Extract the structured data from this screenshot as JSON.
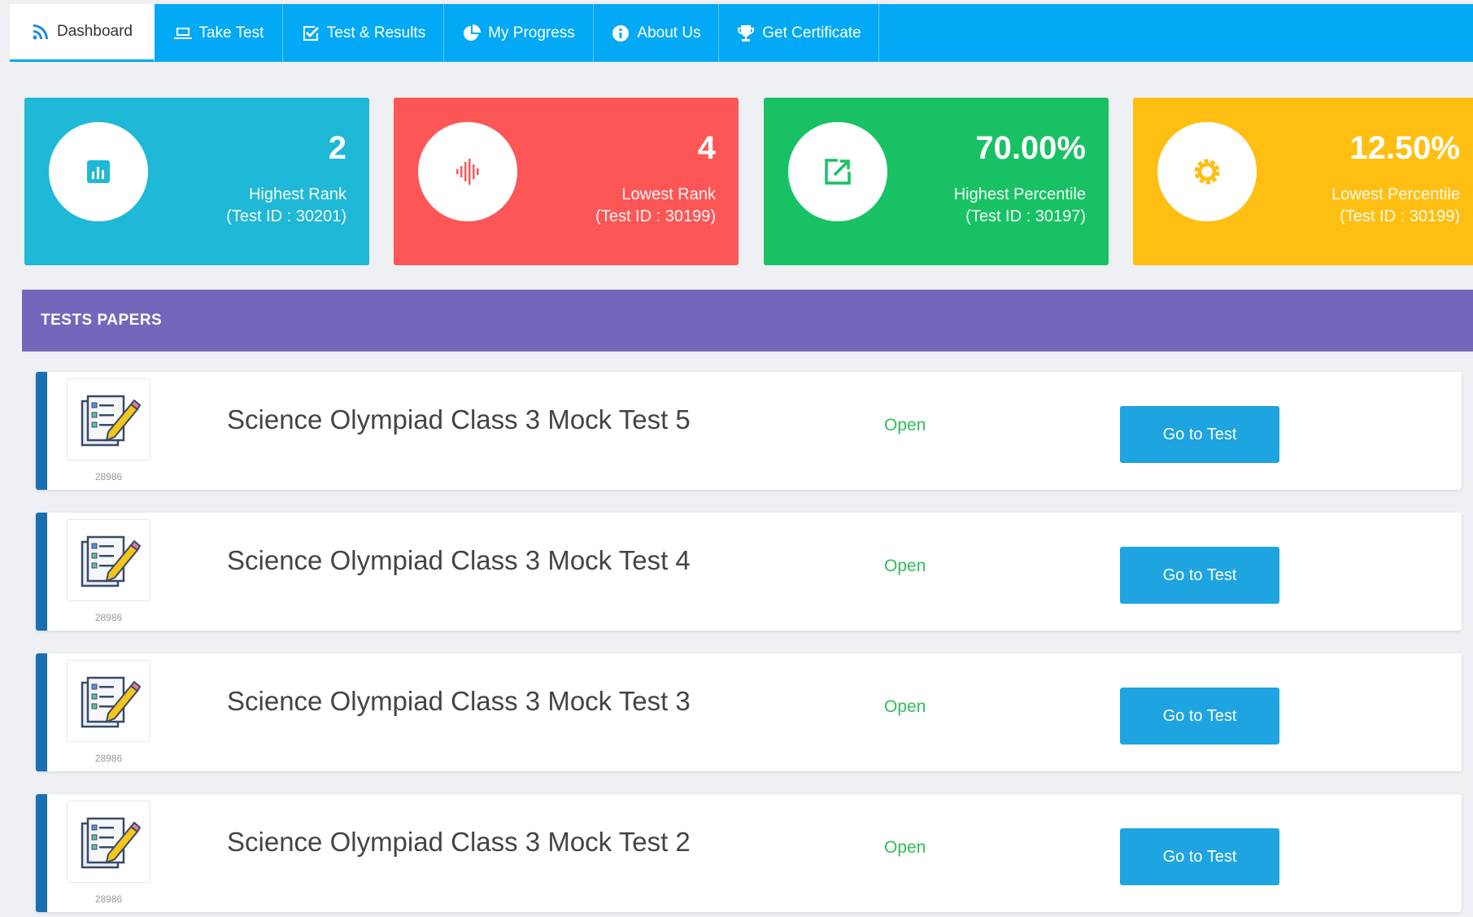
{
  "nav": {
    "items": [
      {
        "label": "Dashboard",
        "icon": "rss-icon",
        "active": true
      },
      {
        "label": "Take Test",
        "icon": "laptop-icon"
      },
      {
        "label": "Test & Results",
        "icon": "checkbox-icon"
      },
      {
        "label": "My Progress",
        "icon": "pie-chart-icon"
      },
      {
        "label": "About Us",
        "icon": "info-icon"
      },
      {
        "label": "Get Certificate",
        "icon": "trophy-icon"
      }
    ]
  },
  "stats": [
    {
      "value": "2",
      "label_line1": "Highest Rank",
      "label_line2": "(Test ID : 30201)",
      "color": "#1fb8d6",
      "icon": "bar-chart-icon"
    },
    {
      "value": "4",
      "label_line1": "Lowest Rank",
      "label_line2": "(Test ID : 30199)",
      "color": "#fd5656",
      "icon": "audio-wave-icon"
    },
    {
      "value": "70.00%",
      "label_line1": "Highest Percentile",
      "label_line2": "(Test ID : 30197)",
      "color": "#18c264",
      "icon": "external-link-icon"
    },
    {
      "value": "12.50%",
      "label_line1": "Lowest Percentile",
      "label_line2": "(Test ID : 30199)",
      "color": "#ffbf12",
      "icon": "gear-icon"
    }
  ],
  "section": {
    "title": "TESTS PAPERS"
  },
  "tests": [
    {
      "id": "28986",
      "title": "Science Olympiad Class 3 Mock Test 5",
      "status": "Open",
      "button": "Go to Test"
    },
    {
      "id": "28986",
      "title": "Science Olympiad Class 3 Mock Test 4",
      "status": "Open",
      "button": "Go to Test"
    },
    {
      "id": "28986",
      "title": "Science Olympiad Class 3 Mock Test 3",
      "status": "Open",
      "button": "Go to Test"
    },
    {
      "id": "28986",
      "title": "Science Olympiad Class 3 Mock Test 2",
      "status": "Open",
      "button": "Go to Test"
    }
  ],
  "colors": {
    "nav": "#03a9f4",
    "section": "#7467bb",
    "row_accent": "#1a6fb0",
    "button": "#1ea4e0",
    "status_open": "#2fbd5a"
  }
}
